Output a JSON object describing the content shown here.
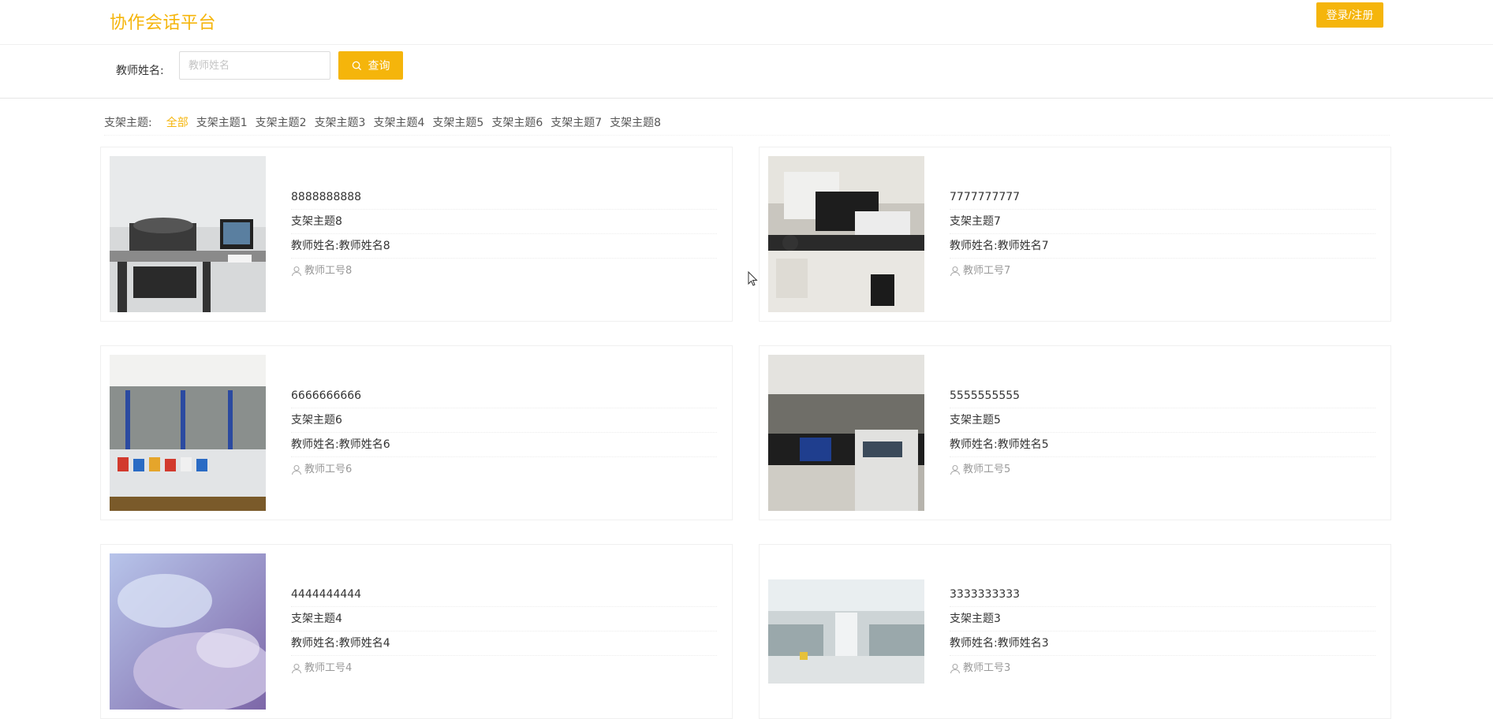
{
  "header": {
    "logo": "协作会话平台",
    "login_label": "登录/注册"
  },
  "search": {
    "label": "教师姓名:",
    "placeholder": "教师姓名",
    "value": "",
    "button_label": "查询"
  },
  "filter": {
    "label": "支架主题:",
    "items": [
      "全部",
      "支架主题1",
      "支架主题2",
      "支架主题3",
      "支架主题4",
      "支架主题5",
      "支架主题6",
      "支架主题7",
      "支架主题8"
    ],
    "active": "全部"
  },
  "cards": [
    {
      "title": "8888888888",
      "topic": "支架主题8",
      "teacher": "教师姓名:教师姓名8",
      "teacher_id": "教师工号8",
      "image": "lab-instrument-photo"
    },
    {
      "title": "7777777777",
      "topic": "支架主题7",
      "teacher": "教师姓名:教师姓名7",
      "teacher_id": "教师工号7",
      "image": "lab-hplc-photo"
    },
    {
      "title": "6666666666",
      "topic": "支架主题6",
      "teacher": "教师姓名:教师姓名6",
      "teacher_id": "教师工号6",
      "image": "lab-bottles-photo"
    },
    {
      "title": "5555555555",
      "topic": "支架主题5",
      "teacher": "教师姓名:教师姓名5",
      "teacher_id": "教师工号5",
      "image": "lab-bench-photo"
    },
    {
      "title": "4444444444",
      "topic": "支架主题4",
      "teacher": "教师姓名:教师姓名4",
      "teacher_id": "教师工号4",
      "image": "glove-petri-dish-photo"
    },
    {
      "title": "3333333333",
      "topic": "支架主题3",
      "teacher": "教师姓名:教师姓名3",
      "teacher_id": "教师工号3",
      "image": "lab-corridor-photo"
    }
  ],
  "colors": {
    "accent": "#f5b50b",
    "border": "#f0f0f0"
  }
}
